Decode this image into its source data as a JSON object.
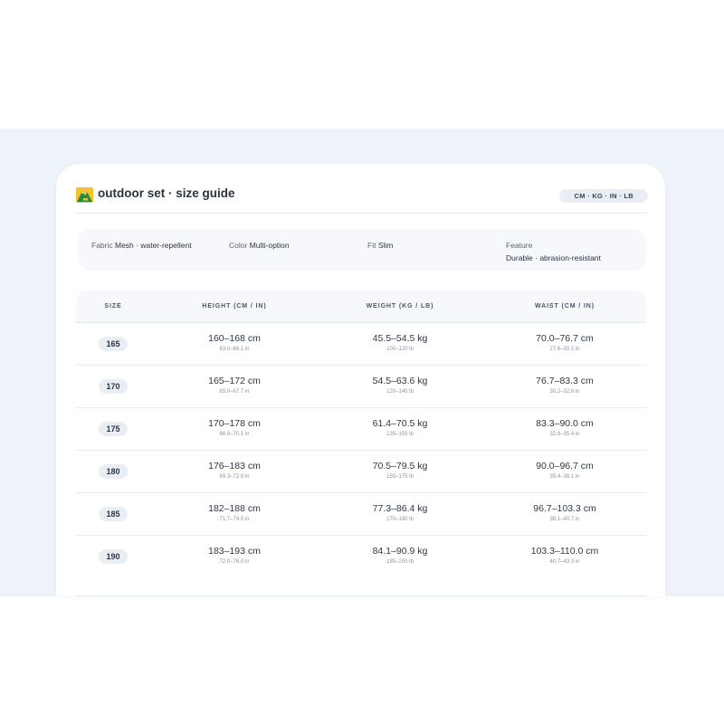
{
  "header": {
    "title": "outdoor set · size guide",
    "units_label": "CM · KG · IN · LB",
    "logo_icon": "mountain-logo-icon"
  },
  "specs": {
    "fabric_key": "Fabric",
    "fabric_value": "Mesh · water-repellent",
    "color_key": "Color",
    "color_value": "Multi-option",
    "fit_key": "Fit",
    "fit_value": "Slim",
    "feature_key": "Feature",
    "feature_value": "Durable · abrasion-resistant"
  },
  "table": {
    "headers": [
      "SIZE",
      "HEIGHT (CM / IN)",
      "WEIGHT (KG / LB)",
      "WAIST (CM / IN)"
    ],
    "rows": [
      {
        "size": "165",
        "height": "160–168 cm",
        "height_sub": "63.0–66.1 in",
        "weight": "45.5–54.5 kg",
        "weight_sub": "100–120 lb",
        "waist": "70.0–76.7 cm",
        "waist_sub": "27.6–30.2 in"
      },
      {
        "size": "170",
        "height": "165–172 cm",
        "height_sub": "65.0–67.7 in",
        "weight": "54.5–63.6 kg",
        "weight_sub": "120–140 lb",
        "waist": "76.7–83.3 cm",
        "waist_sub": "30.2–32.8 in"
      },
      {
        "size": "175",
        "height": "170–178 cm",
        "height_sub": "66.9–70.1 in",
        "weight": "61.4–70.5 kg",
        "weight_sub": "135–155 lb",
        "waist": "83.3–90.0 cm",
        "waist_sub": "32.8–35.4 in"
      },
      {
        "size": "180",
        "height": "176–183 cm",
        "height_sub": "69.3–72.0 in",
        "weight": "70.5–79.5 kg",
        "weight_sub": "155–175 lb",
        "waist": "90.0–96.7 cm",
        "waist_sub": "35.4–38.1 in"
      },
      {
        "size": "185",
        "height": "182–188 cm",
        "height_sub": "71.7–74.0 in",
        "weight": "77.3–86.4 kg",
        "weight_sub": "170–190 lb",
        "waist": "96.7–103.3 cm",
        "waist_sub": "38.1–40.7 in"
      },
      {
        "size": "190",
        "height": "183–193 cm",
        "height_sub": "72.0–76.0 in",
        "weight": "84.1–90.9 kg",
        "weight_sub": "185–200 lb",
        "waist": "103.3–110.0 cm",
        "waist_sub": "40.7–43.3 in"
      }
    ]
  },
  "colors": {
    "backdrop": "#eef3f9",
    "card": "#ffffff",
    "badge": "#e9eef5",
    "logo_green": "#2f8a3e",
    "logo_yellow": "#f2c12e"
  }
}
